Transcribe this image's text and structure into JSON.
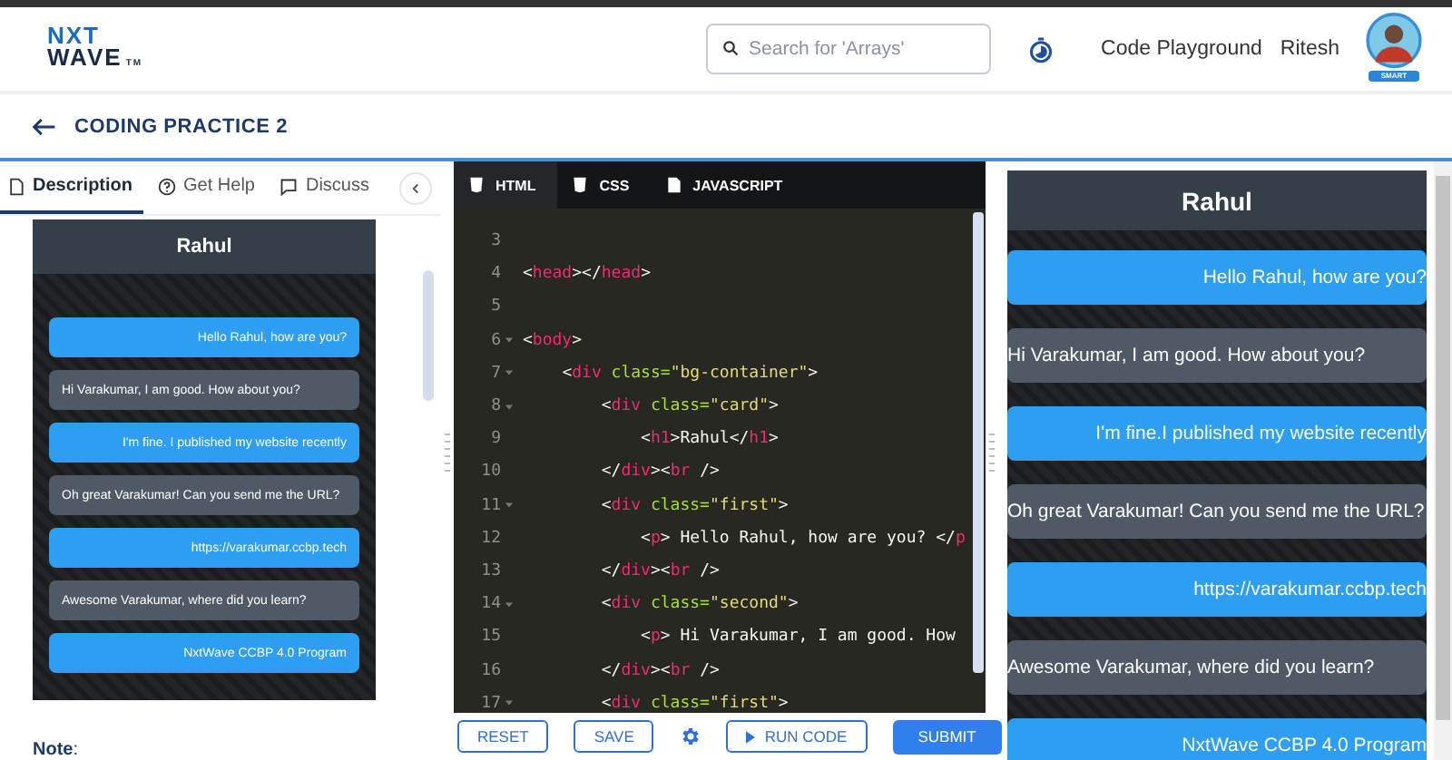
{
  "header": {
    "logo_top": "NXT",
    "logo_bottom": "WAVE",
    "logo_tm": "TM",
    "search": {
      "placeholder": "Search for 'Arrays'"
    },
    "link": "Code Playground",
    "user": "Ritesh",
    "avatar_badge": "SMART"
  },
  "breadcrumb": {
    "title": "CODING PRACTICE 2"
  },
  "left_tabs": [
    {
      "label": "Description",
      "selected": true
    },
    {
      "label": "Get Help",
      "selected": false
    },
    {
      "label": "Discuss",
      "selected": false
    }
  ],
  "left_preview": {
    "title": "Rahul",
    "messages": [
      {
        "text": "Hello Rahul, how are you?",
        "kind": "sent"
      },
      {
        "text": "Hi Varakumar, I am good. How about you?",
        "kind": "received"
      },
      {
        "text": "I'm fine. I published my website recently",
        "kind": "sent"
      },
      {
        "text": "Oh great Varakumar! Can you send me the URL?",
        "kind": "received"
      },
      {
        "text": "https://varakumar.ccbp.tech",
        "kind": "sent"
      },
      {
        "text": "Awesome Varakumar, where did you learn?",
        "kind": "received"
      },
      {
        "text": "NxtWave CCBP 4.0 Program",
        "kind": "sent"
      }
    ]
  },
  "note_label": "Note",
  "note_colon": ":",
  "editor_tabs": [
    {
      "label": "HTML",
      "selected": true
    },
    {
      "label": "CSS",
      "selected": false
    },
    {
      "label": "JAVASCRIPT",
      "selected": false
    }
  ],
  "code_lines": [
    {
      "number": "3",
      "fold": false
    },
    {
      "number": "4",
      "fold": false,
      "text": "<head></head>"
    },
    {
      "number": "5",
      "fold": false
    },
    {
      "number": "6",
      "fold": true,
      "text": "<body>"
    },
    {
      "number": "7",
      "fold": true,
      "text": "    <div class=\"bg-container\">"
    },
    {
      "number": "8",
      "fold": true,
      "text": "        <div class=\"card\">"
    },
    {
      "number": "9",
      "fold": false,
      "text": "            <h1>Rahul</h1>"
    },
    {
      "number": "10",
      "fold": false,
      "text": "        </div><br />"
    },
    {
      "number": "11",
      "fold": true,
      "text": "        <div class=\"first\">"
    },
    {
      "number": "12",
      "fold": false,
      "text": "            <p> Hello Rahul, how are you? </p"
    },
    {
      "number": "13",
      "fold": false,
      "text": "        </div><br />"
    },
    {
      "number": "14",
      "fold": true,
      "text": "        <div class=\"second\">"
    },
    {
      "number": "15",
      "fold": false,
      "text": "            <p> Hi Varakumar, I am good. How"
    },
    {
      "number": "16",
      "fold": false,
      "text": "        </div><br />"
    },
    {
      "number": "17",
      "fold": true,
      "text": "        <div class=\"first\">"
    }
  ],
  "editor_buttons": [
    {
      "label": "RESET",
      "kind": "outline"
    },
    {
      "label": "SAVE",
      "kind": "outline"
    },
    {
      "kind": "settings"
    },
    {
      "label": "RUN CODE",
      "kind": "run"
    },
    {
      "label": "SUBMIT",
      "kind": "primary"
    }
  ],
  "output_preview": {
    "title": "Rahul",
    "messages": [
      {
        "text": "Hello Rahul, how are you?",
        "kind": "sent"
      },
      {
        "text": "Hi Varakumar, I am good. How about you?",
        "kind": "received"
      },
      {
        "text": "I'm fine.I published my website recently",
        "kind": "sent"
      },
      {
        "text": "Oh great Varakumar! Can you send me the URL?",
        "kind": "received"
      },
      {
        "text": "https://varakumar.ccbp.tech",
        "kind": "sent"
      },
      {
        "text": "Awesome Varakumar, where did you learn?",
        "kind": "received"
      },
      {
        "text": "NxtWave CCBP 4.0 Program",
        "kind": "sent"
      }
    ]
  }
}
